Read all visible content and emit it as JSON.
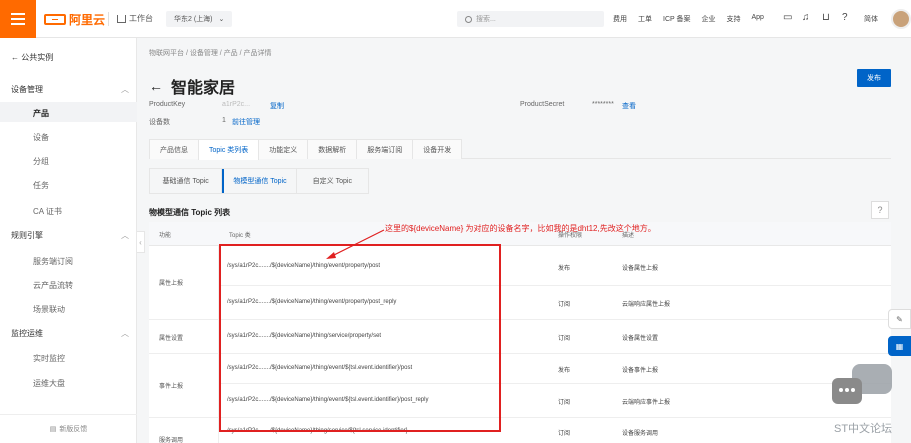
{
  "topbar": {
    "brand": "阿里云",
    "workspace": "工作台",
    "region": "华东2 (上海)",
    "search_placeholder": "搜索...",
    "nav": [
      "费用",
      "工单",
      "ICP 备案",
      "企业",
      "支持",
      "App"
    ],
    "lang": "简体"
  },
  "sidebar": {
    "back": "公共实例",
    "groups": [
      {
        "label": "设备管理",
        "items": [
          "产品",
          "设备",
          "分组",
          "任务",
          "CA 证书"
        ]
      },
      {
        "label": "规则引擎",
        "items": [
          "服务端订阅",
          "云产品流转",
          "场景联动"
        ]
      },
      {
        "label": "监控运维",
        "items": [
          "实时监控",
          "运维大盘"
        ]
      }
    ],
    "footer": "新版反馈"
  },
  "breadcrumb": [
    "物联网平台",
    "设备管理",
    "产品",
    "产品详情"
  ],
  "page": {
    "title": "智能家居",
    "publish": "发布",
    "product_key_label": "ProductKey",
    "product_key_value": "a1rP2c...",
    "copy": "复制",
    "product_secret_label": "ProductSecret",
    "product_secret_value": "********",
    "view": "查看",
    "device_count_label": "设备数",
    "device_count_value": "1",
    "device_manage": "前往管理"
  },
  "tabs": [
    "产品信息",
    "Topic 类列表",
    "功能定义",
    "数据解析",
    "服务端订阅",
    "设备开发"
  ],
  "subtabs": [
    "基础通信 Topic",
    "物模型通信 Topic",
    "自定义 Topic"
  ],
  "section_title": "物模型通信 Topic 列表",
  "annotation": "这里的${deviceName} 为对应的设备名字，比如我的是dht12,先改这个地方。",
  "table": {
    "headers": [
      "功能",
      "Topic 类",
      "操作权限",
      "描述"
    ],
    "groups": [
      {
        "func": "属性上报",
        "rows": [
          {
            "topic": "/sys/a1rP2c......./${deviceName}/thing/event/property/post",
            "perm": "发布",
            "desc": "设备属性上报"
          },
          {
            "topic": "/sys/a1rP2c......./${deviceName}/thing/event/property/post_reply",
            "perm": "订阅",
            "desc": "云端响应属性上报"
          }
        ]
      },
      {
        "func": "属性设置",
        "rows": [
          {
            "topic": "/sys/a1rP2c......./${deviceName}/thing/service/property/set",
            "perm": "订阅",
            "desc": "设备属性设置"
          }
        ]
      },
      {
        "func": "事件上报",
        "rows": [
          {
            "topic": "/sys/a1rP2c......./${deviceName}/thing/event/${tsl.event.identifier}/post",
            "perm": "发布",
            "desc": "设备事件上报"
          },
          {
            "topic": "/sys/a1rP2c......./${deviceName}/thing/event/${tsl.event.identifier}/post_reply",
            "perm": "订阅",
            "desc": "云端响应事件上报"
          }
        ]
      },
      {
        "func": "服务调用",
        "rows": [
          {
            "topic": "/sys/a1rP2c......./${deviceName}/thing/service/${tsl.service.identifier}",
            "perm": "订阅",
            "desc": "设备服务调用"
          }
        ]
      }
    ]
  },
  "watermark": "ST中文论坛"
}
